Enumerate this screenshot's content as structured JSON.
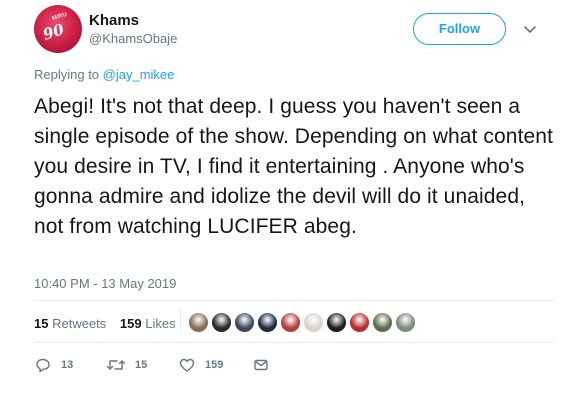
{
  "author": {
    "display_name": "Khams",
    "handle": "@KhamsObaje",
    "avatar_text": "90",
    "avatar_small_text": "MIRU"
  },
  "follow_button": {
    "label": "Follow"
  },
  "reply": {
    "prefix": "Replying to ",
    "mention": "@jay_mikee"
  },
  "tweet_text": "Abegi! It's not that deep. I guess you haven't seen a single episode of the show. Depending on what content you desire in TV, I find it entertaining . Anyone who's gonna admire and idolize the devil will do it unaided, not from watching LUCIFER abeg.",
  "timestamp": "10:40 PM - 13 May 2019",
  "stats": {
    "retweets_count": "15",
    "retweets_label": "Retweets",
    "likes_count": "159",
    "likes_label": "Likes"
  },
  "liker_avatar_colors": [
    "#8a6d55",
    "#2b2b2b",
    "#3a4a5a",
    "#1f2e3c",
    "#b04040",
    "#d9d4cc",
    "#1e1e1e",
    "#b82e2e",
    "#5d6e4c",
    "#7c8a80"
  ],
  "actions": {
    "reply_count": "13",
    "retweet_count": "15",
    "like_count": "159"
  },
  "colors": {
    "accent": "#1da1f2",
    "secondary_text": "#657786",
    "primary_text": "#14171a"
  }
}
